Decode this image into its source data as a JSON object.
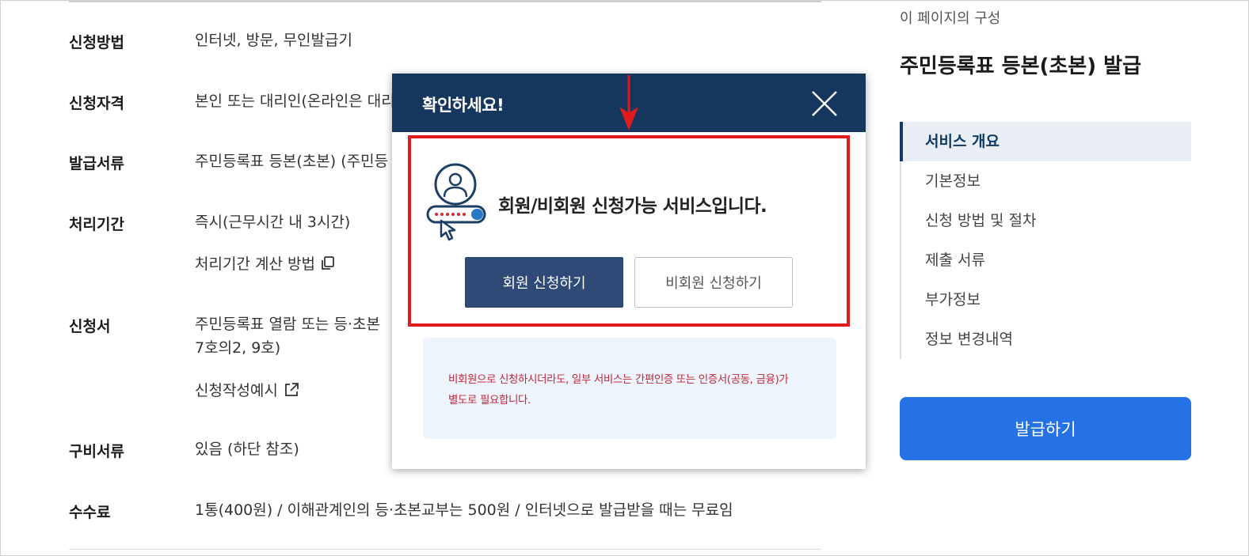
{
  "info": {
    "rows": [
      {
        "label": "신청방법",
        "value": "인터넷, 방문, 무인발급기"
      },
      {
        "label": "신청자격",
        "value": "본인 또는 대리인(온라인은 대리"
      },
      {
        "label": "발급서류",
        "value": "주민등록표 등본(초본) (주민등"
      },
      {
        "label": "처리기간",
        "value": "즉시(근무시간 내 3시간)"
      },
      {
        "label": "신청서",
        "value": "주민등록표 열람 또는 등·초본 ",
        "value2": "7호의2, 9호)"
      },
      {
        "label": "구비서류",
        "value": "있음 (하단 참조)"
      },
      {
        "label": "수수료",
        "value": "1통(400원) / 이해관계인의 등·초본교부는 500원 / 인터넷으로 발급받을 때는 무료임"
      }
    ],
    "processing_calc_link": "처리기간 계산 방법",
    "application_example_link": "신청작성예시"
  },
  "sidebar": {
    "caption": "이 페이지의 구성",
    "title": "주민등록표 등본(초본) 발급",
    "nav": [
      {
        "label": "서비스 개요",
        "active": true
      },
      {
        "label": "기본정보",
        "active": false
      },
      {
        "label": "신청 방법 및 절차",
        "active": false
      },
      {
        "label": "제출 서류",
        "active": false
      },
      {
        "label": "부가정보",
        "active": false
      },
      {
        "label": "정보 변경내역",
        "active": false
      }
    ],
    "issue_button": "발급하기"
  },
  "modal": {
    "title": "확인하세요!",
    "message": "회원/비회원 신청가능 서비스입니다.",
    "member_button": "회원 신청하기",
    "nonmember_button": "비회원 신청하기",
    "notice_line1": "비회원으로 신청하시더라도, 일부 서비스는 간편인증 또는 인증서(공동, 금융)가",
    "notice_line2": "별도로 필요합니다."
  },
  "colors": {
    "modal_header": "#15365d",
    "highlight_border": "#e01b1b",
    "member_button": "#2f4a77",
    "issue_button": "#2572e6",
    "notice_text": "#c1273b",
    "notice_bg": "#eef4fb"
  },
  "icons": [
    "close-icon",
    "copy-icon",
    "external-link-icon",
    "user-login-icon",
    "down-arrow-icon"
  ]
}
